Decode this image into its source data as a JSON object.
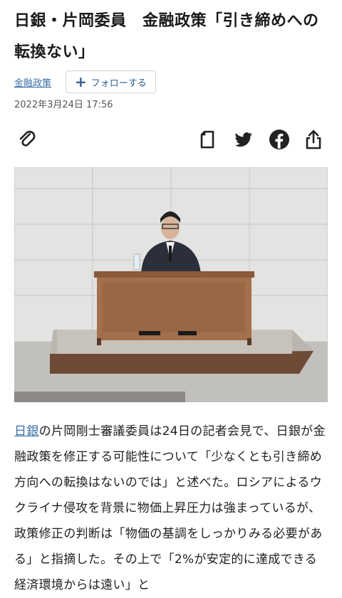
{
  "article": {
    "headline_line1": "日銀・片岡委員　金融政策「引き締めへの",
    "headline_line2": "転換ない」",
    "category": "金融政策",
    "follow_label": "フォローする",
    "date": "2022年3月24日 17:56"
  },
  "toolbar": {
    "icons": [
      "paperclip-icon",
      "bookmark-icon",
      "twitter-icon",
      "facebook-icon",
      "share-icon"
    ]
  },
  "body": {
    "link_term": "日銀",
    "text_after_link": "の片岡剛士審議委員は24日の記者会見で、日銀が金融政策を修正する可能性について「少なくとも引き締め方向への転換はないのでは」と述べた。ロシアによるウクライナ侵攻を背景に物価上昇圧力は強まっているが、政策修正の判断は「物価の基調をしっかりみる必要がある」と指摘した。その上で「2%が安定的に達成できる経済環境からは遠い」と"
  }
}
